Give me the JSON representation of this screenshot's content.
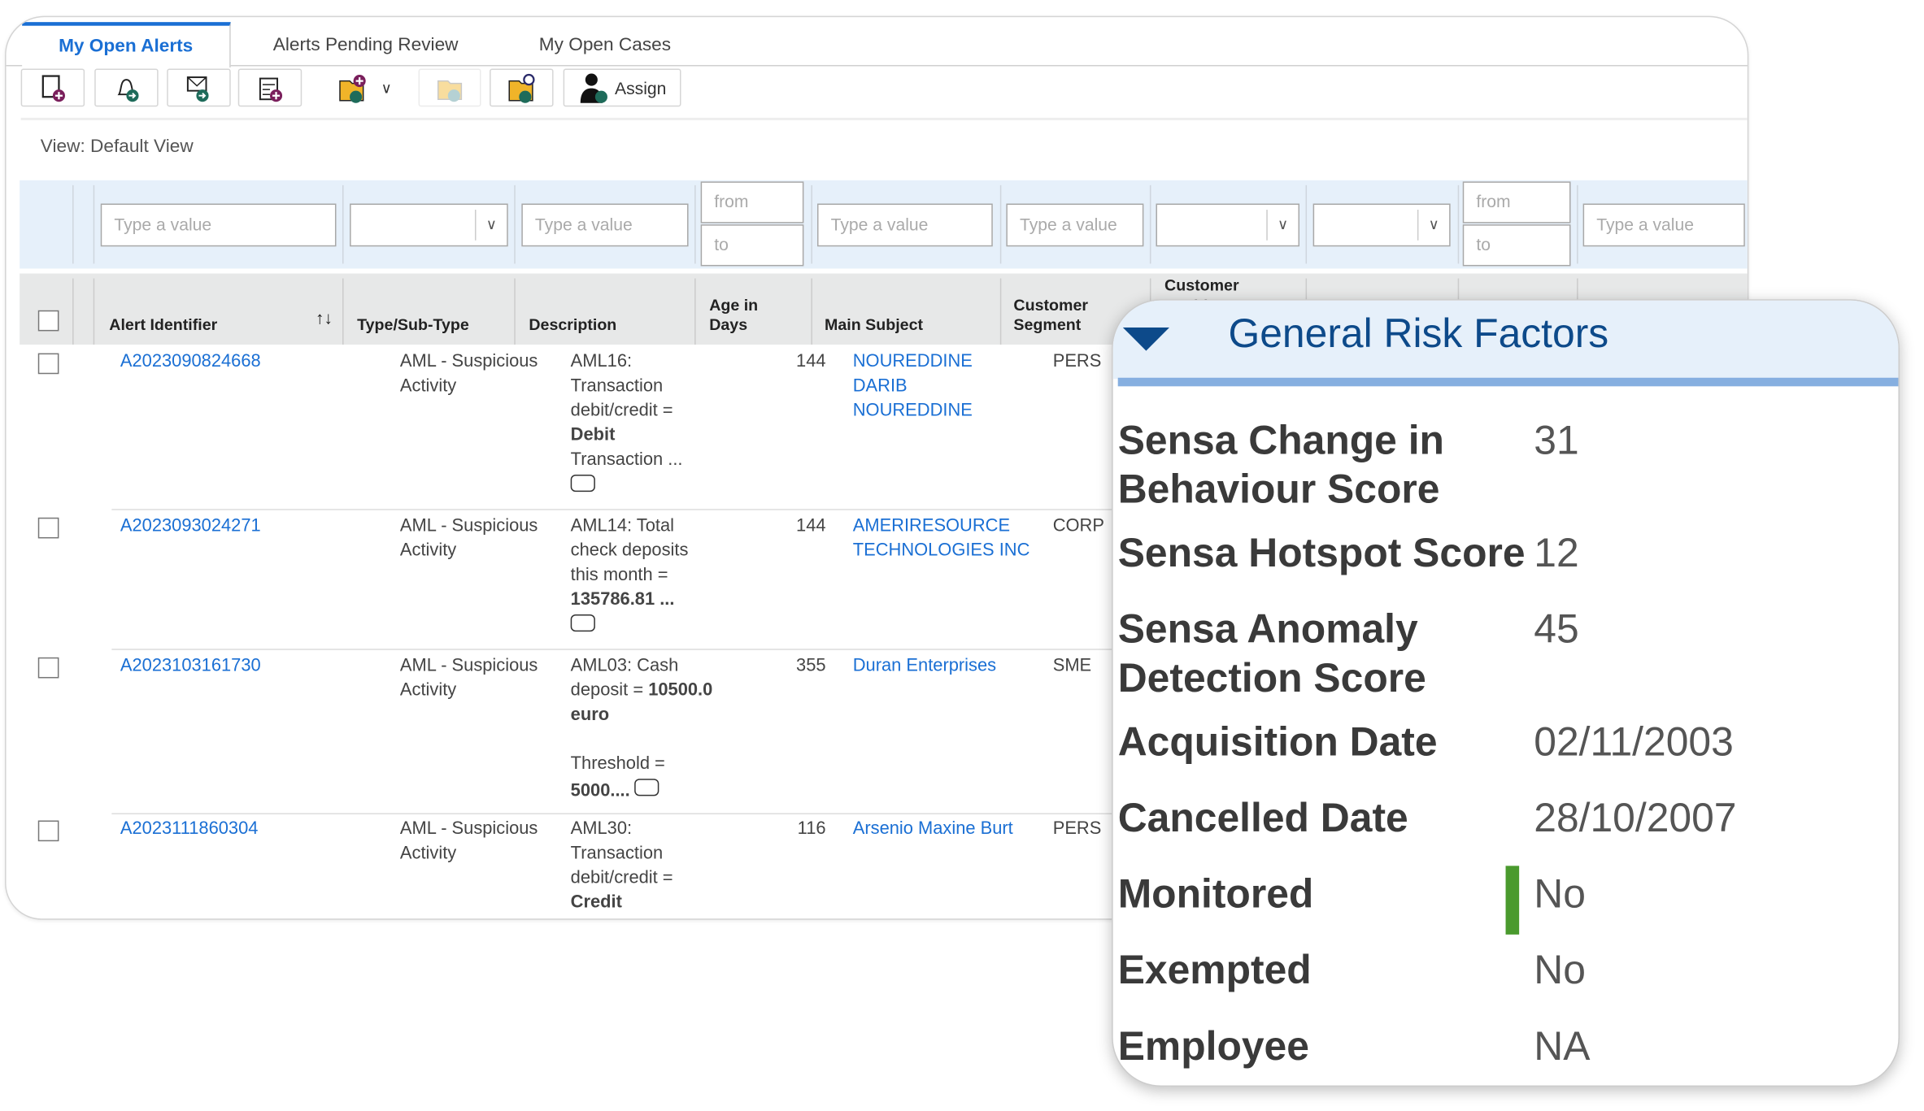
{
  "tabs": [
    {
      "label": "My Open Alerts",
      "active": true
    },
    {
      "label": "Alerts Pending Review"
    },
    {
      "label": "My Open Cases"
    }
  ],
  "toolbar": {
    "assign_label": "Assign",
    "icons": [
      "new-alert-icon",
      "bell-forward-icon",
      "mail-forward-icon",
      "calendar-add-icon",
      "folder-add-icon",
      "folder-forward-icon",
      "folder-search-icon",
      "user-assign-icon"
    ]
  },
  "view_label": "View: Default View",
  "filters": {
    "placeholder": "Type a value",
    "from": "from",
    "to": "to"
  },
  "columns": [
    "Alert Identifier",
    "Type/Sub-Type",
    "Description",
    "Age in Days",
    "Main Subject",
    "Customer Segment",
    "Customer Residence"
  ],
  "rows": [
    {
      "id": "A2023090824668",
      "type": "AML - Suspicious Activity",
      "desc": [
        "AML16: Transaction debit/credit = ",
        "Debit",
        " Transaction ..."
      ],
      "age": "144",
      "subject": "NOUREDDINE DARIB NOUREDDINE",
      "segment": "PERS"
    },
    {
      "id": "A2023093024271",
      "type": "AML - Suspicious Activity",
      "desc": [
        "AML14: Total check deposits this month = ",
        "135786.81",
        " ..."
      ],
      "age": "144",
      "subject": "AMERIRESOURCE TECHNOLOGIES INC",
      "segment": "CORP"
    },
    {
      "id": "A2023103161730",
      "type": "AML - Suspicious Activity",
      "desc": [
        "AML03: Cash deposit = ",
        "10500.0 euro",
        "Threshold = ",
        "5000...."
      ],
      "age": "355",
      "subject": "Duran Enterprises",
      "segment": "SME"
    },
    {
      "id": "A2023111860304",
      "type": "AML - Suspicious Activity",
      "desc": [
        "AML30: Transaction debit/credit = ",
        "Credit"
      ],
      "age": "116",
      "subject": "Arsenio Maxine Burt",
      "segment": "PERS"
    }
  ],
  "panel": {
    "title": "General Risk Factors",
    "accent": "#0d4a8a",
    "items": [
      {
        "label": "Sensa Change in Behaviour Score",
        "value": "31"
      },
      {
        "label": "Sensa Hotspot Score",
        "value": "12"
      },
      {
        "label": "Sensa Anomaly Detection Score",
        "value": "45"
      },
      {
        "label": "Acquisition Date",
        "value": "02/11/2003"
      },
      {
        "label": "Cancelled Date",
        "value": "28/10/2007"
      },
      {
        "label": "Monitored",
        "value": "No",
        "indicator_color": "#4a9a2e"
      },
      {
        "label": "Exempted",
        "value": "No"
      },
      {
        "label": "Employee",
        "value": "NA"
      }
    ]
  }
}
